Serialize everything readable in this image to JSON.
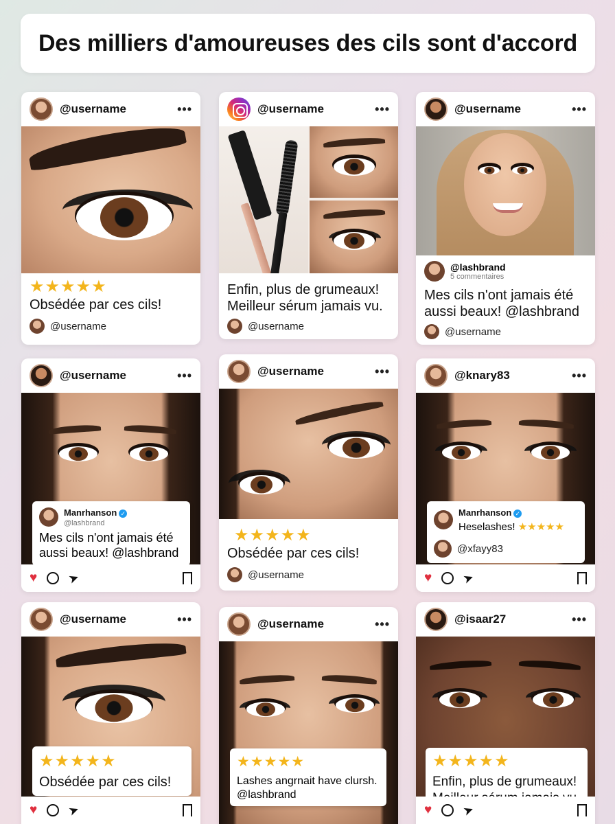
{
  "title": "Des milliers d'amoureuses des cils sont d'accord",
  "icons": {
    "more": "more-dots-icon",
    "like": "heart-icon",
    "comment": "comment-icon",
    "share": "send-icon",
    "save": "bookmark-icon",
    "verified": "verified-icon",
    "instagram": "instagram-logo-icon"
  },
  "colors": {
    "star": "#f3b51c",
    "heart": "#e0303f",
    "verified": "#1d9bf0"
  },
  "cards": [
    {
      "username": "@username",
      "stars": "★★★★★",
      "text": "Obsédée par ces cils!",
      "reviewer": "@username"
    },
    {
      "username": "@username",
      "text_line1": "Enfin, plus de grumeaux!",
      "text_line2": "Meilleur sérum jamais vu.",
      "reviewer": "@username"
    },
    {
      "username": "@username",
      "brand": "@lashbrand",
      "comments": "5 commentaires",
      "text_line1": "Mes cils n'ont jamais été",
      "text_line2": "aussi beaux! @lashbrand",
      "reviewer": "@username"
    },
    {
      "username": "@username",
      "bubble_name": "Manrhanson",
      "bubble_handle": "@lashbrand",
      "bubble_line1": "Mes cils n'ont jamais été",
      "bubble_line2": "aussi beaux! @lashbrand"
    },
    {
      "username": "@username",
      "stars": "★★★★★",
      "text": "Obsédée par ces cils!",
      "reviewer": "@username"
    },
    {
      "username": "@knary83",
      "bubble_name": "Manrhanson",
      "bubble_text": "Heselashes!",
      "bubble_stars": "★★★★★",
      "bubble_user": "@xfayy83"
    },
    {
      "username": "@username",
      "stars": "★★★★★",
      "text": "Obsédée par ces cils!"
    },
    {
      "username": "@username",
      "stars": "★★★★★",
      "text_line1": "Lashes angrnait have clursh.",
      "text_line2": "@lashbrand"
    },
    {
      "username": "@isaar27",
      "stars": "★★★★★",
      "text_line1": "Enfin, plus de grumeaux!",
      "text_line2": "Meilleur sérum jamais vu."
    }
  ]
}
